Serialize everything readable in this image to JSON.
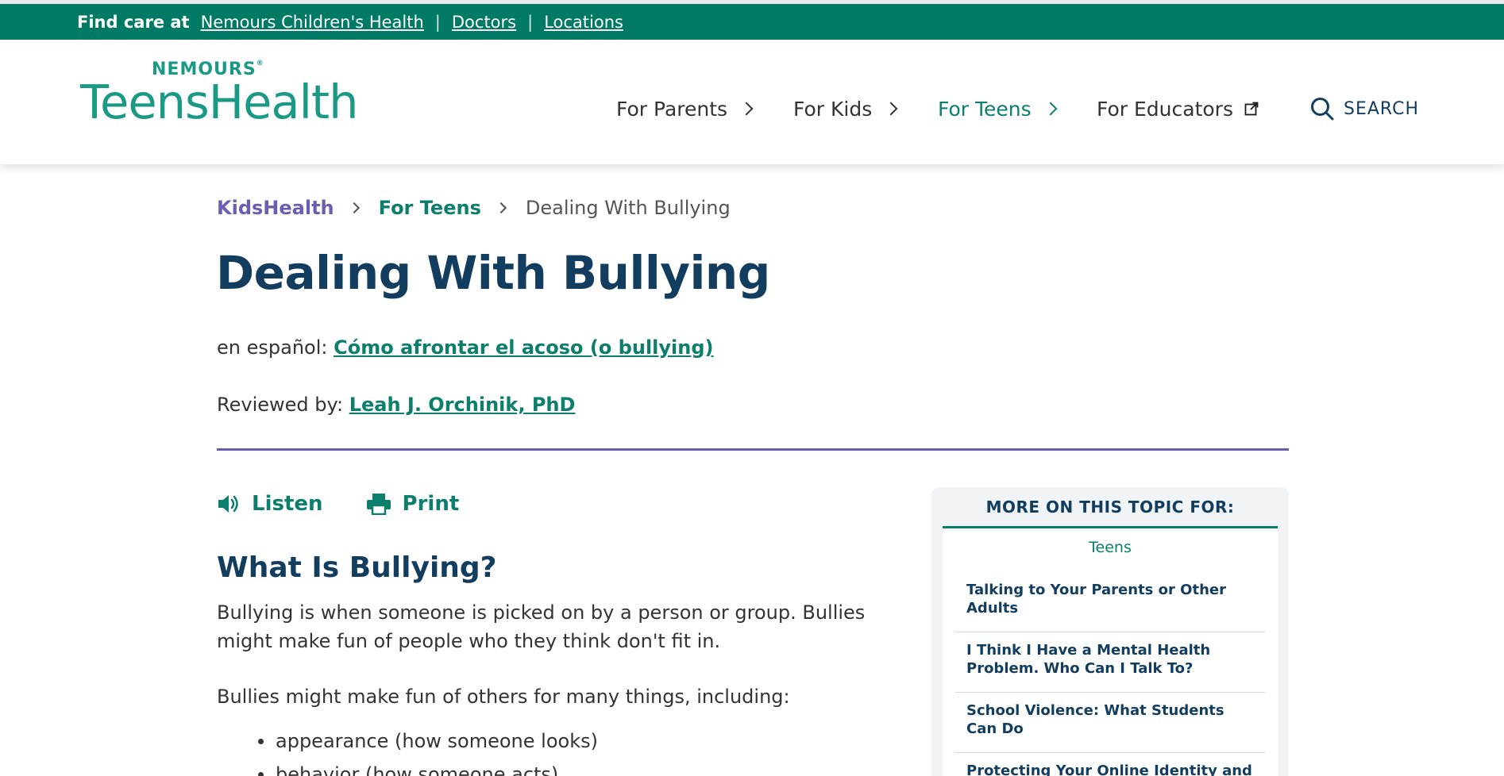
{
  "utility_bar": {
    "label": "Find care at",
    "links": [
      "Nemours Children's Health",
      "Doctors",
      "Locations"
    ],
    "separator": "|"
  },
  "brand": {
    "parent": "NEMOURS",
    "registered": "®",
    "name": "TeensHealth"
  },
  "nav": {
    "items": [
      {
        "label": "For Parents"
      },
      {
        "label": "For Kids"
      },
      {
        "label": "For Teens",
        "active": true
      },
      {
        "label": "For Educators",
        "external": true
      }
    ],
    "search_label": "SEARCH"
  },
  "breadcrumb": {
    "items": [
      "KidsHealth",
      "For Teens",
      "Dealing With Bullying"
    ]
  },
  "article": {
    "title": "Dealing With Bullying",
    "spanish_prefix": "en español:",
    "spanish_link": "Cómo afrontar el acoso (o bullying)",
    "reviewed_prefix": "Reviewed by:",
    "reviewer": "Leah J. Orchinik, PhD",
    "tools": {
      "listen": "Listen",
      "print": "Print"
    },
    "section_heading": "What Is Bullying?",
    "para1": "Bullying is when someone is picked on by a person or group. Bullies might make fun of people who they think don't fit in.",
    "para2": "Bullies might make fun of others for many things, including:",
    "list": [
      "appearance (how someone looks)",
      "behavior (how someone acts)"
    ]
  },
  "sidebar": {
    "heading": "MORE ON THIS TOPIC FOR:",
    "tab": "Teens",
    "items": [
      "Talking to Your Parents or Other Adults",
      "I Think I Have a Mental Health Problem. Who Can I Talk To?",
      "School Violence: What Students Can Do",
      "Protecting Your Online Identity and Reputation"
    ]
  },
  "colors": {
    "brand_green": "#007a64",
    "teal": "#1a9a85",
    "navy": "#123d5e",
    "purple": "#6d5db0"
  }
}
